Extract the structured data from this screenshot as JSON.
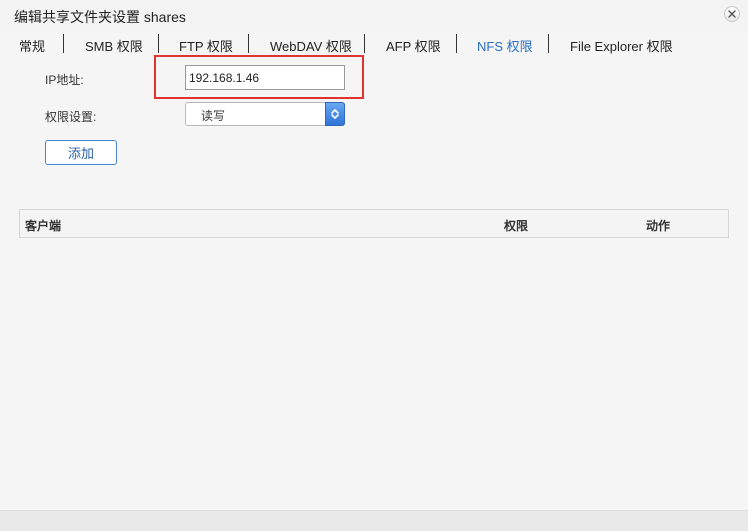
{
  "window": {
    "title": "编辑共享文件夹设置 shares"
  },
  "tabs": [
    {
      "label": "常规"
    },
    {
      "label": "SMB 权限"
    },
    {
      "label": "FTP 权限"
    },
    {
      "label": "WebDAV 权限"
    },
    {
      "label": "AFP 权限"
    },
    {
      "label": "NFS 权限",
      "active": true
    },
    {
      "label": "File Explorer 权限"
    }
  ],
  "form": {
    "ip_label": "IP地址:",
    "ip_value": "192.168.1.46",
    "permission_label": "权限设置:",
    "permission_value": "读写",
    "add_button": "添加"
  },
  "table": {
    "columns": [
      "客户端",
      "权限",
      "动作"
    ],
    "rows": []
  },
  "colors": {
    "active_tab": "#2a6ec2",
    "highlight": "#e0322e"
  },
  "icons": {
    "close": "close-icon",
    "dropdown": "chevron-updown-icon"
  }
}
